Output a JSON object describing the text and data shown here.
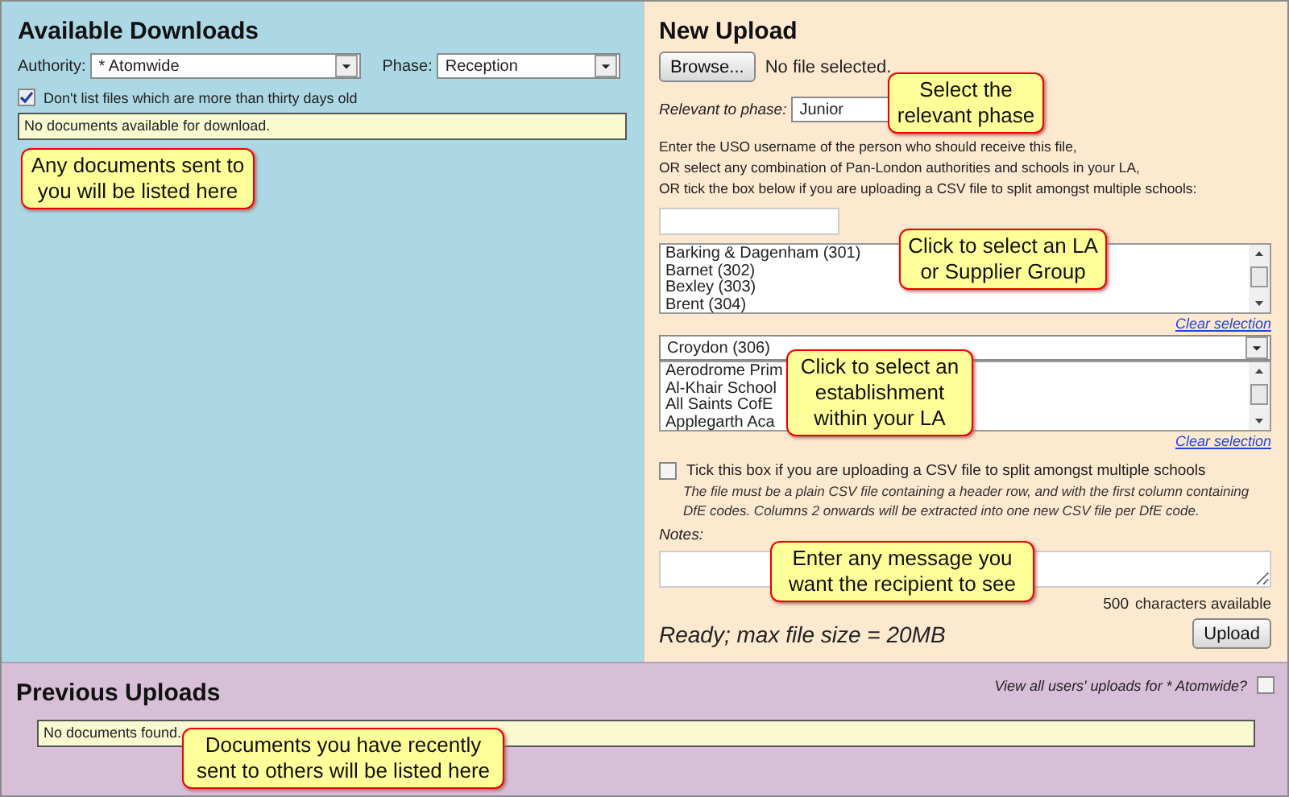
{
  "downloads": {
    "title": "Available Downloads",
    "authority_label": "Authority:",
    "authority_value": "* Atomwide",
    "phase_label": "Phase:",
    "phase_value": "Reception",
    "age_filter": {
      "label": "Don't list files which are more than thirty days old",
      "checked": true
    },
    "empty_message": "No documents available for download.",
    "callout": "Any documents sent to you will be listed here"
  },
  "upload": {
    "title": "New Upload",
    "browse_button": "Browse...",
    "file_status": "No file selected.",
    "phase_label": "Relevant to phase:",
    "phase_value": "Junior",
    "phase_callout": "Select the relevant phase",
    "instructions": [
      "Enter the USO username of the person who should receive this file,",
      "OR select any combination of Pan-London authorities and schools in your LA,",
      "OR tick the box below if you are uploading a CSV file to split amongst multiple schools:"
    ],
    "authorities": {
      "items": [
        "Barking & Dagenham (301)",
        "Barnet (302)",
        "Bexley (303)",
        "Brent (304)"
      ],
      "clear": "Clear selection",
      "callout": "Click to select an LA or Supplier Group"
    },
    "la_select": "Croydon (306)",
    "establishments": {
      "items": [
        "Aerodrome Prim",
        "Al-Khair School",
        "All Saints CofE",
        "Applegarth Aca"
      ],
      "clear": "Clear selection",
      "callout": "Click to select an establishment within your LA"
    },
    "csv": {
      "label": "Tick this box if you are uploading a CSV file to split amongst multiple schools",
      "checked": false,
      "note": "The file must be a plain CSV file containing a header row, and with the first column containing DfE codes. Columns 2 onwards will be extracted into one new CSV file per DfE code."
    },
    "notes_label": "Notes:",
    "notes_callout": "Enter any message you want the recipient to see",
    "char_count": "500",
    "char_label": "characters available",
    "status": "Ready; max file size = 20MB",
    "upload_button": "Upload"
  },
  "previous": {
    "title": "Previous Uploads",
    "view_all": {
      "label": "View all users' uploads for * Atomwide?",
      "checked": false
    },
    "empty_message": "No documents found.",
    "callout": "Documents you have recently sent to others will be listed here"
  }
}
